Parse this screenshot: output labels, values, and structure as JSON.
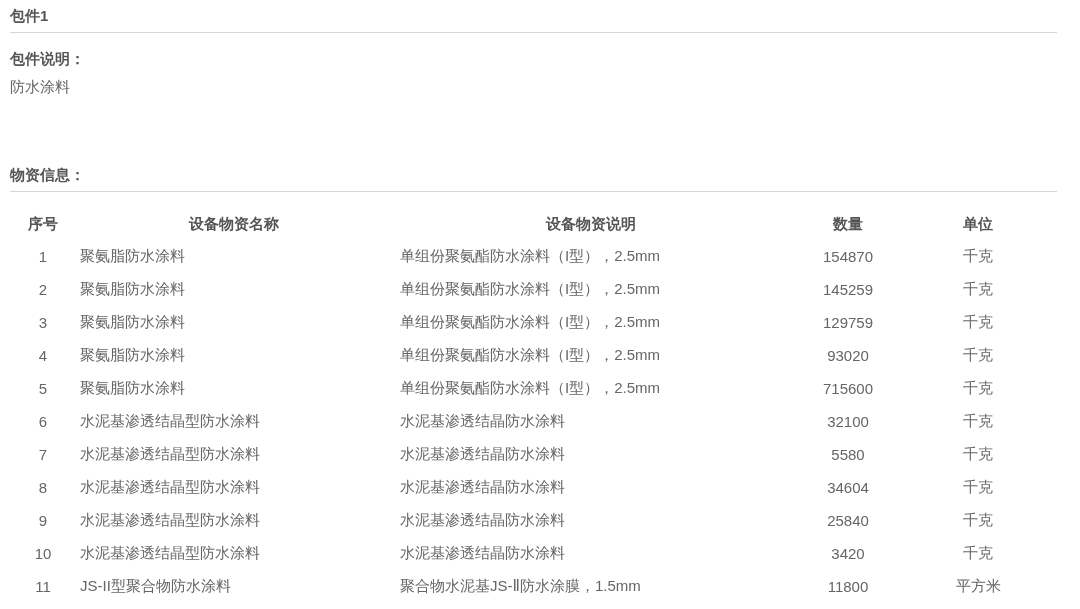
{
  "package_title": "包件1",
  "package_description": {
    "label": "包件说明：",
    "value": "防水涂料"
  },
  "materials": {
    "label": "物资信息：",
    "table": {
      "columns": [
        "序号",
        "设备物资名称",
        "设备物资说明",
        "数量",
        "单位"
      ],
      "rows": [
        [
          "1",
          "聚氨脂防水涂料",
          "单组份聚氨酯防水涂料（I型），2.5mm",
          "154870",
          "千克"
        ],
        [
          "2",
          "聚氨脂防水涂料",
          "单组份聚氨酯防水涂料（I型），2.5mm",
          "145259",
          "千克"
        ],
        [
          "3",
          "聚氨脂防水涂料",
          "单组份聚氨酯防水涂料（I型），2.5mm",
          "129759",
          "千克"
        ],
        [
          "4",
          "聚氨脂防水涂料",
          "单组份聚氨酯防水涂料（I型），2.5mm",
          "93020",
          "千克"
        ],
        [
          "5",
          "聚氨脂防水涂料",
          "单组份聚氨酯防水涂料（I型），2.5mm",
          "715600",
          "千克"
        ],
        [
          "6",
          "水泥基渗透结晶型防水涂料",
          "水泥基渗透结晶防水涂料",
          "32100",
          "千克"
        ],
        [
          "7",
          "水泥基渗透结晶型防水涂料",
          "水泥基渗透结晶防水涂料",
          "5580",
          "千克"
        ],
        [
          "8",
          "水泥基渗透结晶型防水涂料",
          "水泥基渗透结晶防水涂料",
          "34604",
          "千克"
        ],
        [
          "9",
          "水泥基渗透结晶型防水涂料",
          "水泥基渗透结晶防水涂料",
          "25840",
          "千克"
        ],
        [
          "10",
          "水泥基渗透结晶型防水涂料",
          "水泥基渗透结晶防水涂料",
          "3420",
          "千克"
        ],
        [
          "11",
          "JS-II型聚合物防水涂料",
          "聚合物水泥基JS-Ⅱ防水涂膜，1.5mm",
          "11800",
          "平方米"
        ]
      ]
    }
  }
}
